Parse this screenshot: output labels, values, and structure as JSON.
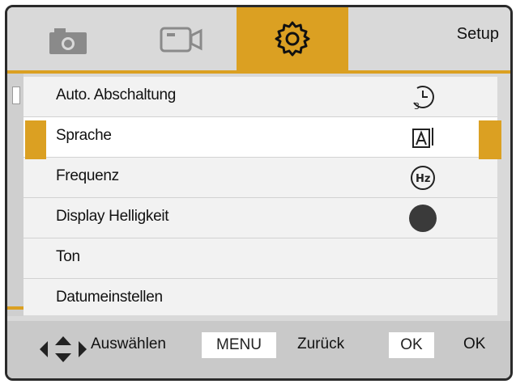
{
  "header": {
    "title": "Setup",
    "tabs": [
      {
        "icon": "camera-icon",
        "active": false
      },
      {
        "icon": "video-icon",
        "active": false
      },
      {
        "icon": "gear-icon",
        "active": true
      }
    ],
    "accent": "#dba022"
  },
  "menu": {
    "items": [
      {
        "label": "Auto. Abschaltung",
        "icon": "auto-off-timer-icon"
      },
      {
        "label": "Sprache",
        "icon": "language-icon",
        "selected": true
      },
      {
        "label": "Frequenz",
        "icon": "hz-icon"
      },
      {
        "label": "Display Helligkeit",
        "icon": "brightness-dot-icon"
      },
      {
        "label": "Ton",
        "icon": ""
      },
      {
        "label": "Datumeinstellen",
        "icon": ""
      }
    ]
  },
  "footer": {
    "select_label": "Auswählen",
    "menu_key": "MENU",
    "back_label": "Zurück",
    "ok_key": "OK",
    "ok_label": "OK"
  }
}
